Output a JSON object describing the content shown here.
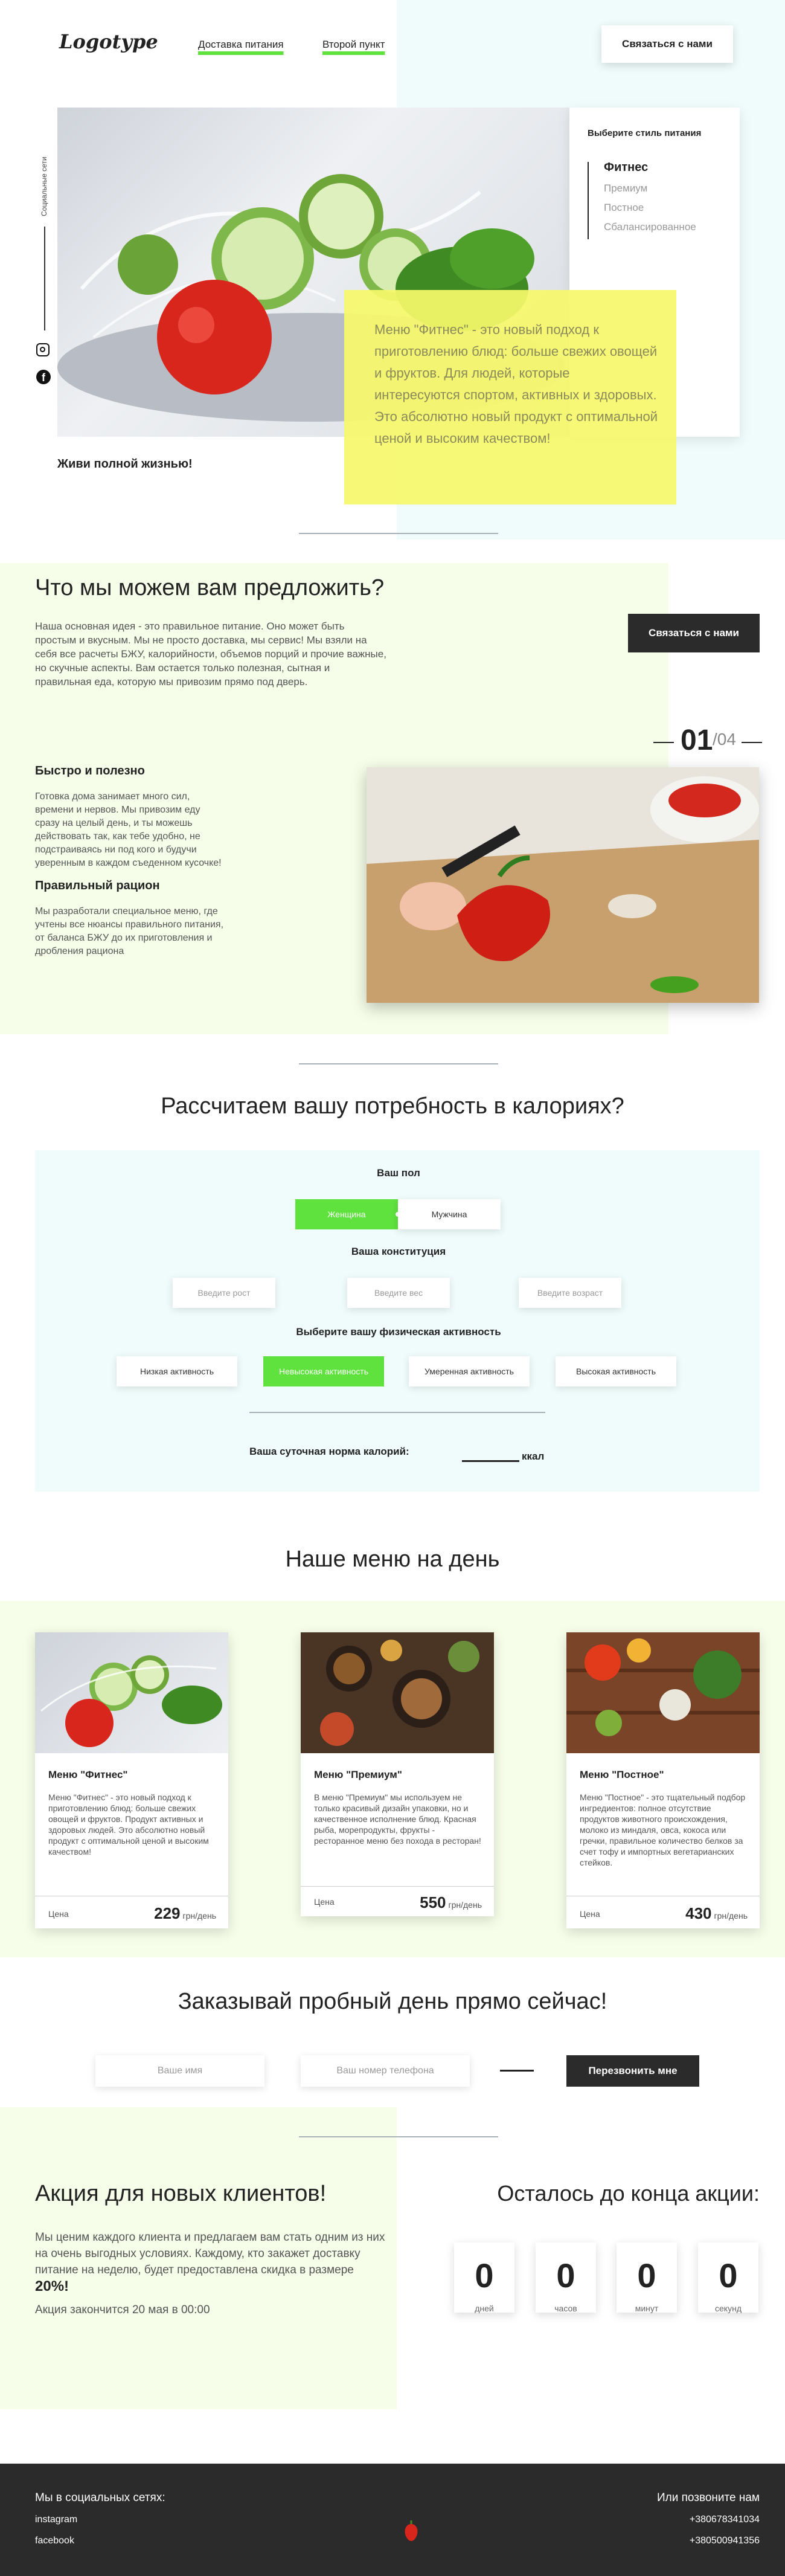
{
  "header": {
    "logo": "Logotype",
    "nav": [
      "Доставка питания",
      "Второй пункт"
    ],
    "contact_button": "Связаться с нами"
  },
  "hero": {
    "social_label": "Социальные сети",
    "slogan": "Живи полной жизнью!",
    "style_title": "Выберите стиль питания",
    "styles": [
      "Фитнес",
      "Премиум",
      "Постное",
      "Сбалансированное"
    ],
    "description": "Меню \"Фитнес\" - это новый подход к приготовлению блюд: больше свежих овощей и фруктов. Для людей, которые интересуются спортом, активных и здоровых. Это абсолютно новый продукт с оптимальной ценой и высоким качеством!"
  },
  "offer": {
    "title": "Что мы можем вам предложить?",
    "text": "Наша основная идея - это правильное питание. Оно может быть простым и вкусным. Мы не просто доставка, мы сервис! Мы взяли на себя все расчеты БЖУ, калорийности, объемов порций и прочие важные, но скучные аспекты. Вам остается только полезная, сытная и правильная еда, которую мы привозим прямо под дверь.",
    "button": "Связаться с нами",
    "slider_current": "01",
    "slider_total": "/04",
    "features": [
      {
        "title": "Быстро и полезно",
        "text": "Готовка дома занимает много сил, времени и нервов. Мы привозим еду сразу на целый день, и ты можешь действовать так, как тебе удобно, не подстраиваясь ни под кого и будучи уверенным в каждом съеденном кусочке!"
      },
      {
        "title": "Правильный рацион",
        "text": "Мы разработали специальное меню, где учтены все нюансы правильного питания, от баланса БЖУ до их приготовления и дробления рациона"
      }
    ]
  },
  "calc": {
    "title": "Рассчитаем вашу потребность в калориях?",
    "gender_label": "Ваш пол",
    "genders": [
      "Женщина",
      "Мужчина"
    ],
    "constitution_label": "Ваша конституция",
    "height_ph": "Введите рост",
    "weight_ph": "Введите вес",
    "age_ph": "Введите возраст",
    "activity_label": "Выберите вашу физическая активность",
    "activities": [
      "Низкая активность",
      "Невысокая активность",
      "Умеренная активность",
      "Высокая активность"
    ],
    "result_label": "Ваша суточная норма калорий:",
    "result_unit": "ккал"
  },
  "menu": {
    "title": "Наше меню на день",
    "price_label": "Цена",
    "currency": "грн/день",
    "items": [
      {
        "title": "Меню \"Фитнес\"",
        "text": "Меню \"Фитнес\" - это новый подход к приготовлению блюд: больше свежих овощей и фруктов. Продукт активных и здоровых людей. Это абсолютно новый продукт с оптимальной ценой и высоким качеством!",
        "price": "229"
      },
      {
        "title": "Меню \"Премиум\"",
        "text": "В меню \"Премиум\" мы используем не только красивый дизайн упаковки, но и качественное исполнение блюд. Красная рыба, морепродукты, фрукты - ресторанное меню без похода в ресторан!",
        "price": "550"
      },
      {
        "title": "Меню \"Постное\"",
        "text": "Меню \"Постное\" - это тщательный подбор ингредиентов: полное отсутствие продуктов животного происхождения, молоко из миндаля, овса, кокоса или гречки, правильное количество белков за счет тофу и импортных вегетарианских стейков.",
        "price": "430"
      }
    ]
  },
  "order": {
    "title": "Заказывай пробный день прямо сейчас!",
    "name_ph": "Ваше имя",
    "phone_ph": "Ваш номер телефона",
    "button": "Перезвонить мне"
  },
  "promo": {
    "title": "Акция для новых клиентов!",
    "text": "Мы ценим каждого клиента и предлагаем вам стать одним из них на очень выгодных условиях. Каждому, кто закажет доставку питание на неделю, будет предоставлена скидка в размере",
    "discount": "20%!",
    "deadline": "Акция закончится 20 мая в 00:00",
    "timer_title": "Осталось до конца акции:",
    "timer": [
      {
        "value": "0",
        "unit": "дней"
      },
      {
        "value": "0",
        "unit": "часов"
      },
      {
        "value": "0",
        "unit": "минут"
      },
      {
        "value": "0",
        "unit": "секунд"
      }
    ]
  },
  "footer": {
    "social_title": "Мы в социальных сетях:",
    "socials": [
      "instagram",
      "facebook"
    ],
    "call_title": "Или позвоните нам",
    "phones": [
      "+380678341034",
      "+380500941356"
    ]
  },
  "colors": {
    "accent_green": "#5fe23e",
    "highlight_yellow": "#f6f96a",
    "dark": "#2b2b2b",
    "bg_mint": "#effcfb",
    "bg_lime": "#f6fde9"
  }
}
